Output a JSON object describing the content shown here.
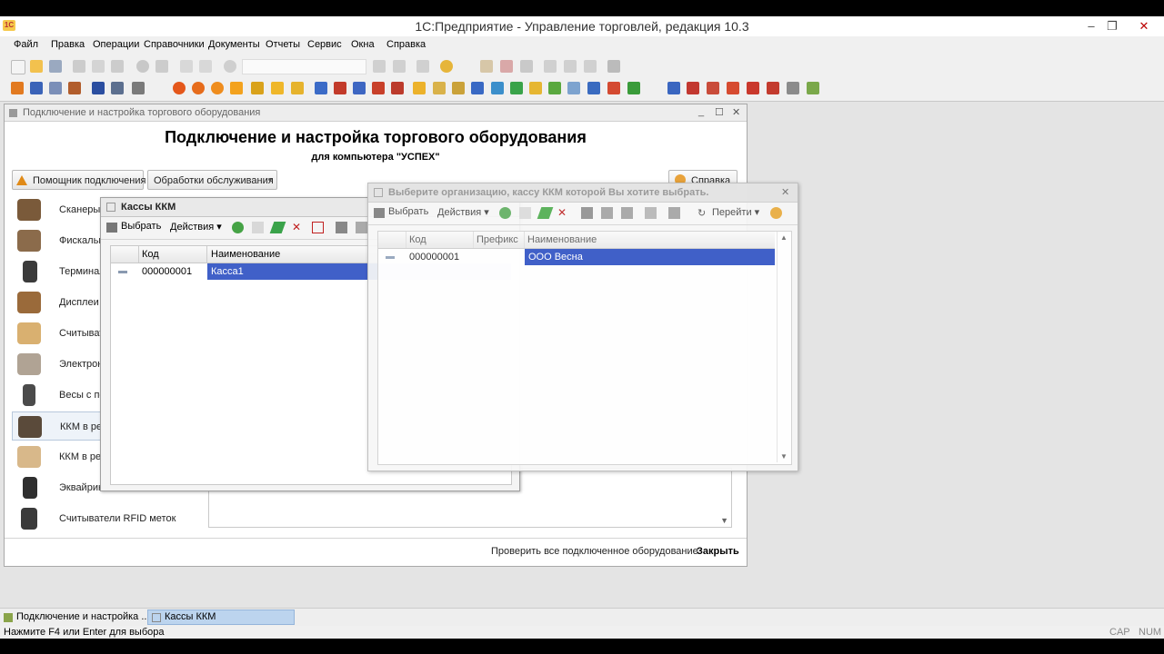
{
  "window": {
    "title": "1С:Предприятие - Управление торговлей, редакция 10.3",
    "app_icon": "1С"
  },
  "menu": [
    "Файл",
    "Правка",
    "Операции",
    "Справочники",
    "Документы",
    "Отчеты",
    "Сервис",
    "Окна",
    "Справка"
  ],
  "main_form": {
    "caption": "Подключение и настройка торгового оборудования",
    "heading": "Подключение и настройка торгового оборудования",
    "subheading": "для компьютера \"УСПЕХ\"",
    "wizard_button": "Помощник подключения",
    "service_button": "Обработки обслуживания",
    "help_button": "Справка",
    "categories": [
      {
        "label": "Сканеры ш",
        "icon": "scanner-icon"
      },
      {
        "label": "Фискальн",
        "icon": "fiscal-icon"
      },
      {
        "label": "Терминал",
        "icon": "terminal-icon"
      },
      {
        "label": "Дисплеи п",
        "icon": "display-icon"
      },
      {
        "label": "Считывате",
        "icon": "reader-icon"
      },
      {
        "label": "Электронн",
        "icon": "scales-icon"
      },
      {
        "label": "Весы с печ",
        "icon": "label-scales-icon"
      },
      {
        "label": "ККМ в реж",
        "icon": "kkm-icon"
      },
      {
        "label": "ККМ в реж",
        "icon": "kkm2-icon"
      },
      {
        "label": "Эквайринг",
        "icon": "acquiring-icon"
      },
      {
        "label": "Считыватели RFID меток",
        "icon": "rfid-icon"
      }
    ],
    "check_all": "Проверить все подключенное оборудование",
    "close": "Закрыть"
  },
  "kkm_window": {
    "title": "Кассы ККМ",
    "select_btn": "Выбрать",
    "actions_btn": "Действия",
    "columns": [
      "Код",
      "Наименование"
    ],
    "rows": [
      {
        "code": "000000001",
        "name": "Касса1"
      }
    ]
  },
  "select_window": {
    "title": "Выберите организацию, кассу ККМ которой Вы хотите выбрать.",
    "select_btn": "Выбрать",
    "actions_btn": "Действия",
    "goto_btn": "Перейти",
    "columns": [
      "Код",
      "Префикс",
      "Наименование"
    ],
    "rows": [
      {
        "code": "000000001",
        "prefix": "",
        "name": "ООО Весна"
      }
    ]
  },
  "taskbar": [
    "Подключение и настройка ...",
    "Кассы ККМ"
  ],
  "status": {
    "hint": "Нажмите F4 или Enter для выбора",
    "cap": "CAP",
    "num": "NUM"
  }
}
